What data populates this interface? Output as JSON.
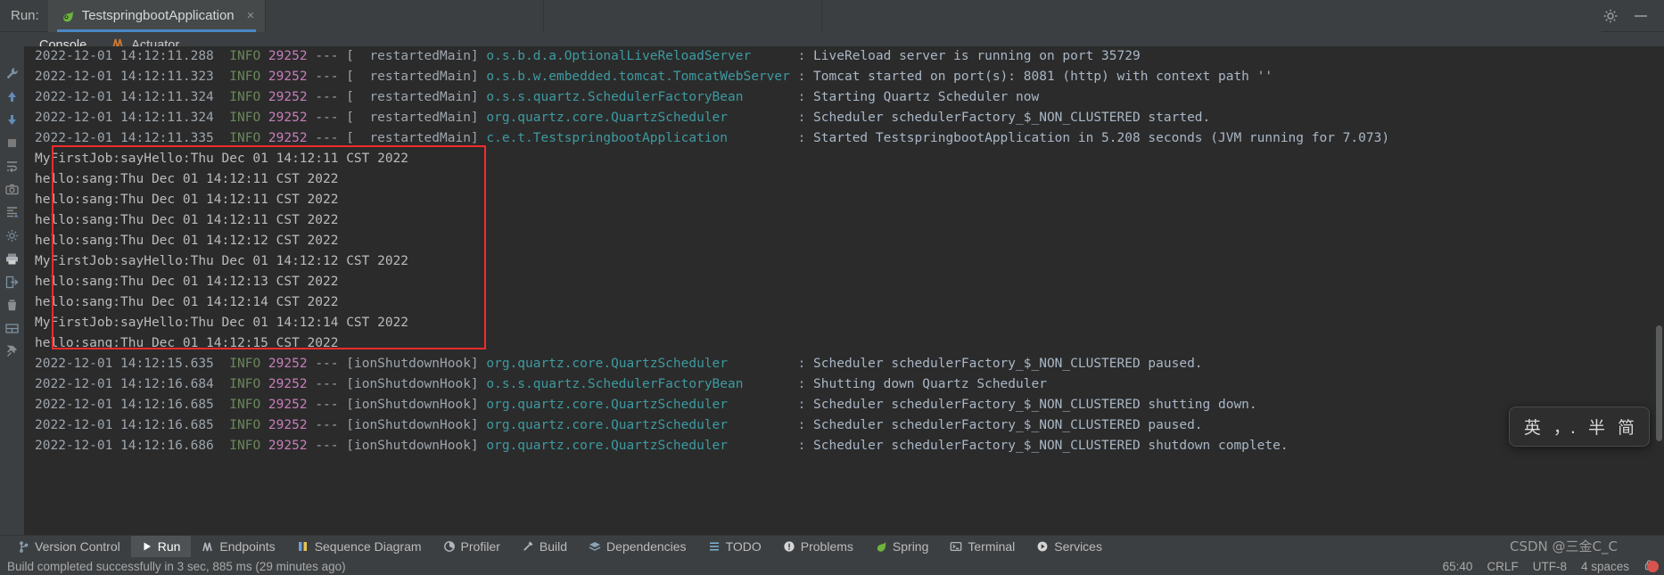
{
  "run_bar": {
    "label": "Run:",
    "tab": {
      "title": "TestspringbootApplication",
      "icon": "spring-leaf-icon",
      "close": "×"
    },
    "settings_icon": "gear-icon",
    "minimize_icon": "minimize-icon"
  },
  "console_tabs": [
    {
      "label": "Console",
      "icon": "console-icon",
      "active": true
    },
    {
      "label": "Actuator",
      "icon": "actuator-icon",
      "active": false
    }
  ],
  "left_gutter": [
    {
      "name": "rerun-button",
      "icon": "play-icon"
    },
    {
      "name": "wrench-button",
      "icon": "wrench-icon"
    },
    {
      "name": "up-stack-button",
      "icon": "arrow-up-icon"
    },
    {
      "name": "down-stack-button",
      "icon": "arrow-down-icon"
    },
    {
      "name": "stop-button",
      "icon": "stop-icon"
    },
    {
      "name": "soft-wrap-button",
      "icon": "wrap-icon"
    },
    {
      "name": "screenshot-button",
      "icon": "camera-icon"
    },
    {
      "name": "scroll-to-end-button",
      "icon": "scroll-end-icon"
    },
    {
      "name": "settings-button",
      "icon": "gear-icon"
    },
    {
      "name": "print-button",
      "icon": "printer-icon"
    },
    {
      "name": "exit-button",
      "icon": "exit-icon"
    },
    {
      "name": "delete-button",
      "icon": "trash-icon"
    },
    {
      "name": "layout-button",
      "icon": "layout-icon"
    },
    {
      "name": "pin-button",
      "icon": "pin-icon"
    }
  ],
  "console": {
    "lines": [
      {
        "type": "log",
        "clipped": true,
        "time": "2022-12-01 14:12:11.288",
        "level": "INFO",
        "pid": "29252",
        "sep": "---",
        "thread": "[  restartedMain]",
        "logger": "o.s.b.d.a.OptionalLiveReloadServer",
        "colon": ": ",
        "message": "LiveReload server is running on port 35729"
      },
      {
        "type": "log",
        "time": "2022-12-01 14:12:11.323",
        "level": "INFO",
        "pid": "29252",
        "sep": "---",
        "thread": "[  restartedMain]",
        "logger": "o.s.b.w.embedded.tomcat.TomcatWebServer",
        "colon": ": ",
        "message": "Tomcat started on port(s): 8081 (http) with context path ''"
      },
      {
        "type": "log",
        "time": "2022-12-01 14:12:11.324",
        "level": "INFO",
        "pid": "29252",
        "sep": "---",
        "thread": "[  restartedMain]",
        "logger": "o.s.s.quartz.SchedulerFactoryBean",
        "colon": ": ",
        "message": "Starting Quartz Scheduler now"
      },
      {
        "type": "log",
        "time": "2022-12-01 14:12:11.324",
        "level": "INFO",
        "pid": "29252",
        "sep": "---",
        "thread": "[  restartedMain]",
        "logger": "org.quartz.core.QuartzScheduler",
        "colon": ": ",
        "message": "Scheduler schedulerFactory_$_NON_CLUSTERED started."
      },
      {
        "type": "log",
        "time": "2022-12-01 14:12:11.335",
        "level": "INFO",
        "pid": "29252",
        "sep": "---",
        "thread": "[  restartedMain]",
        "logger": "c.e.t.TestspringbootApplication",
        "colon": ": ",
        "message": "Started TestspringbootApplication in 5.208 seconds (JVM running for 7.073)"
      },
      {
        "type": "plain",
        "text": "MyFirstJob:sayHello:Thu Dec 01 14:12:11 CST 2022"
      },
      {
        "type": "plain",
        "text": "hello:sang:Thu Dec 01 14:12:11 CST 2022"
      },
      {
        "type": "plain",
        "text": "hello:sang:Thu Dec 01 14:12:11 CST 2022"
      },
      {
        "type": "plain",
        "text": "hello:sang:Thu Dec 01 14:12:11 CST 2022"
      },
      {
        "type": "plain",
        "text": "hello:sang:Thu Dec 01 14:12:12 CST 2022"
      },
      {
        "type": "plain",
        "text": "MyFirstJob:sayHello:Thu Dec 01 14:12:12 CST 2022"
      },
      {
        "type": "plain",
        "text": "hello:sang:Thu Dec 01 14:12:13 CST 2022"
      },
      {
        "type": "plain",
        "text": "hello:sang:Thu Dec 01 14:12:14 CST 2022"
      },
      {
        "type": "plain",
        "text": "MyFirstJob:sayHello:Thu Dec 01 14:12:14 CST 2022"
      },
      {
        "type": "plain",
        "text": "hello:sang:Thu Dec 01 14:12:15 CST 2022"
      },
      {
        "type": "log",
        "time": "2022-12-01 14:12:15.635",
        "level": "INFO",
        "pid": "29252",
        "sep": "---",
        "thread": "[ionShutdownHook]",
        "logger": "org.quartz.core.QuartzScheduler",
        "colon": ": ",
        "message": "Scheduler schedulerFactory_$_NON_CLUSTERED paused."
      },
      {
        "type": "log",
        "time": "2022-12-01 14:12:16.684",
        "level": "INFO",
        "pid": "29252",
        "sep": "---",
        "thread": "[ionShutdownHook]",
        "logger": "o.s.s.quartz.SchedulerFactoryBean",
        "colon": ": ",
        "message": "Shutting down Quartz Scheduler"
      },
      {
        "type": "log",
        "time": "2022-12-01 14:12:16.685",
        "level": "INFO",
        "pid": "29252",
        "sep": "---",
        "thread": "[ionShutdownHook]",
        "logger": "org.quartz.core.QuartzScheduler",
        "colon": ": ",
        "message": "Scheduler schedulerFactory_$_NON_CLUSTERED shutting down."
      },
      {
        "type": "log",
        "time": "2022-12-01 14:12:16.685",
        "level": "INFO",
        "pid": "29252",
        "sep": "---",
        "thread": "[ionShutdownHook]",
        "logger": "org.quartz.core.QuartzScheduler",
        "colon": ": ",
        "message": "Scheduler schedulerFactory_$_NON_CLUSTERED paused."
      },
      {
        "type": "log",
        "clipped_bottom": true,
        "time": "2022-12-01 14:12:16.686",
        "level": "INFO",
        "pid": "29252",
        "sep": "---",
        "thread": "[ionShutdownHook]",
        "logger": "org.quartz.core.QuartzScheduler",
        "colon": ": ",
        "message": "Scheduler schedulerFactory_$_NON_CLUSTERED shutdown complete."
      }
    ],
    "highlight_box_color": "#f52b2b"
  },
  "ime_popup": {
    "items": [
      "英",
      "，.",
      "半",
      "简"
    ]
  },
  "bottom_tabs": [
    {
      "label": "Version Control",
      "icon": "branch-icon",
      "active": false
    },
    {
      "label": "Run",
      "icon": "play-icon",
      "active": true
    },
    {
      "label": "Endpoints",
      "icon": "endpoints-icon",
      "active": false
    },
    {
      "label": "Sequence Diagram",
      "icon": "sequence-diagram-icon",
      "active": false
    },
    {
      "label": "Profiler",
      "icon": "profiler-icon",
      "active": false
    },
    {
      "label": "Build",
      "icon": "hammer-icon",
      "active": false
    },
    {
      "label": "Dependencies",
      "icon": "layers-icon",
      "active": false
    },
    {
      "label": "TODO",
      "icon": "todo-list-icon",
      "active": false
    },
    {
      "label": "Problems",
      "icon": "warning-icon",
      "active": false
    },
    {
      "label": "Spring",
      "icon": "spring-leaf-icon",
      "active": false
    },
    {
      "label": "Terminal",
      "icon": "terminal-icon",
      "active": false
    },
    {
      "label": "Services",
      "icon": "services-icon",
      "active": false
    }
  ],
  "status_bar": {
    "message": "Build completed successfully in 3 sec, 885 ms (29 minutes ago)",
    "caret": "65:40",
    "line_separator": "CRLF",
    "encoding": "UTF-8",
    "indent": "4 spaces",
    "lock_icon": "lock-icon"
  },
  "watermark": "CSDN @三金C_C"
}
